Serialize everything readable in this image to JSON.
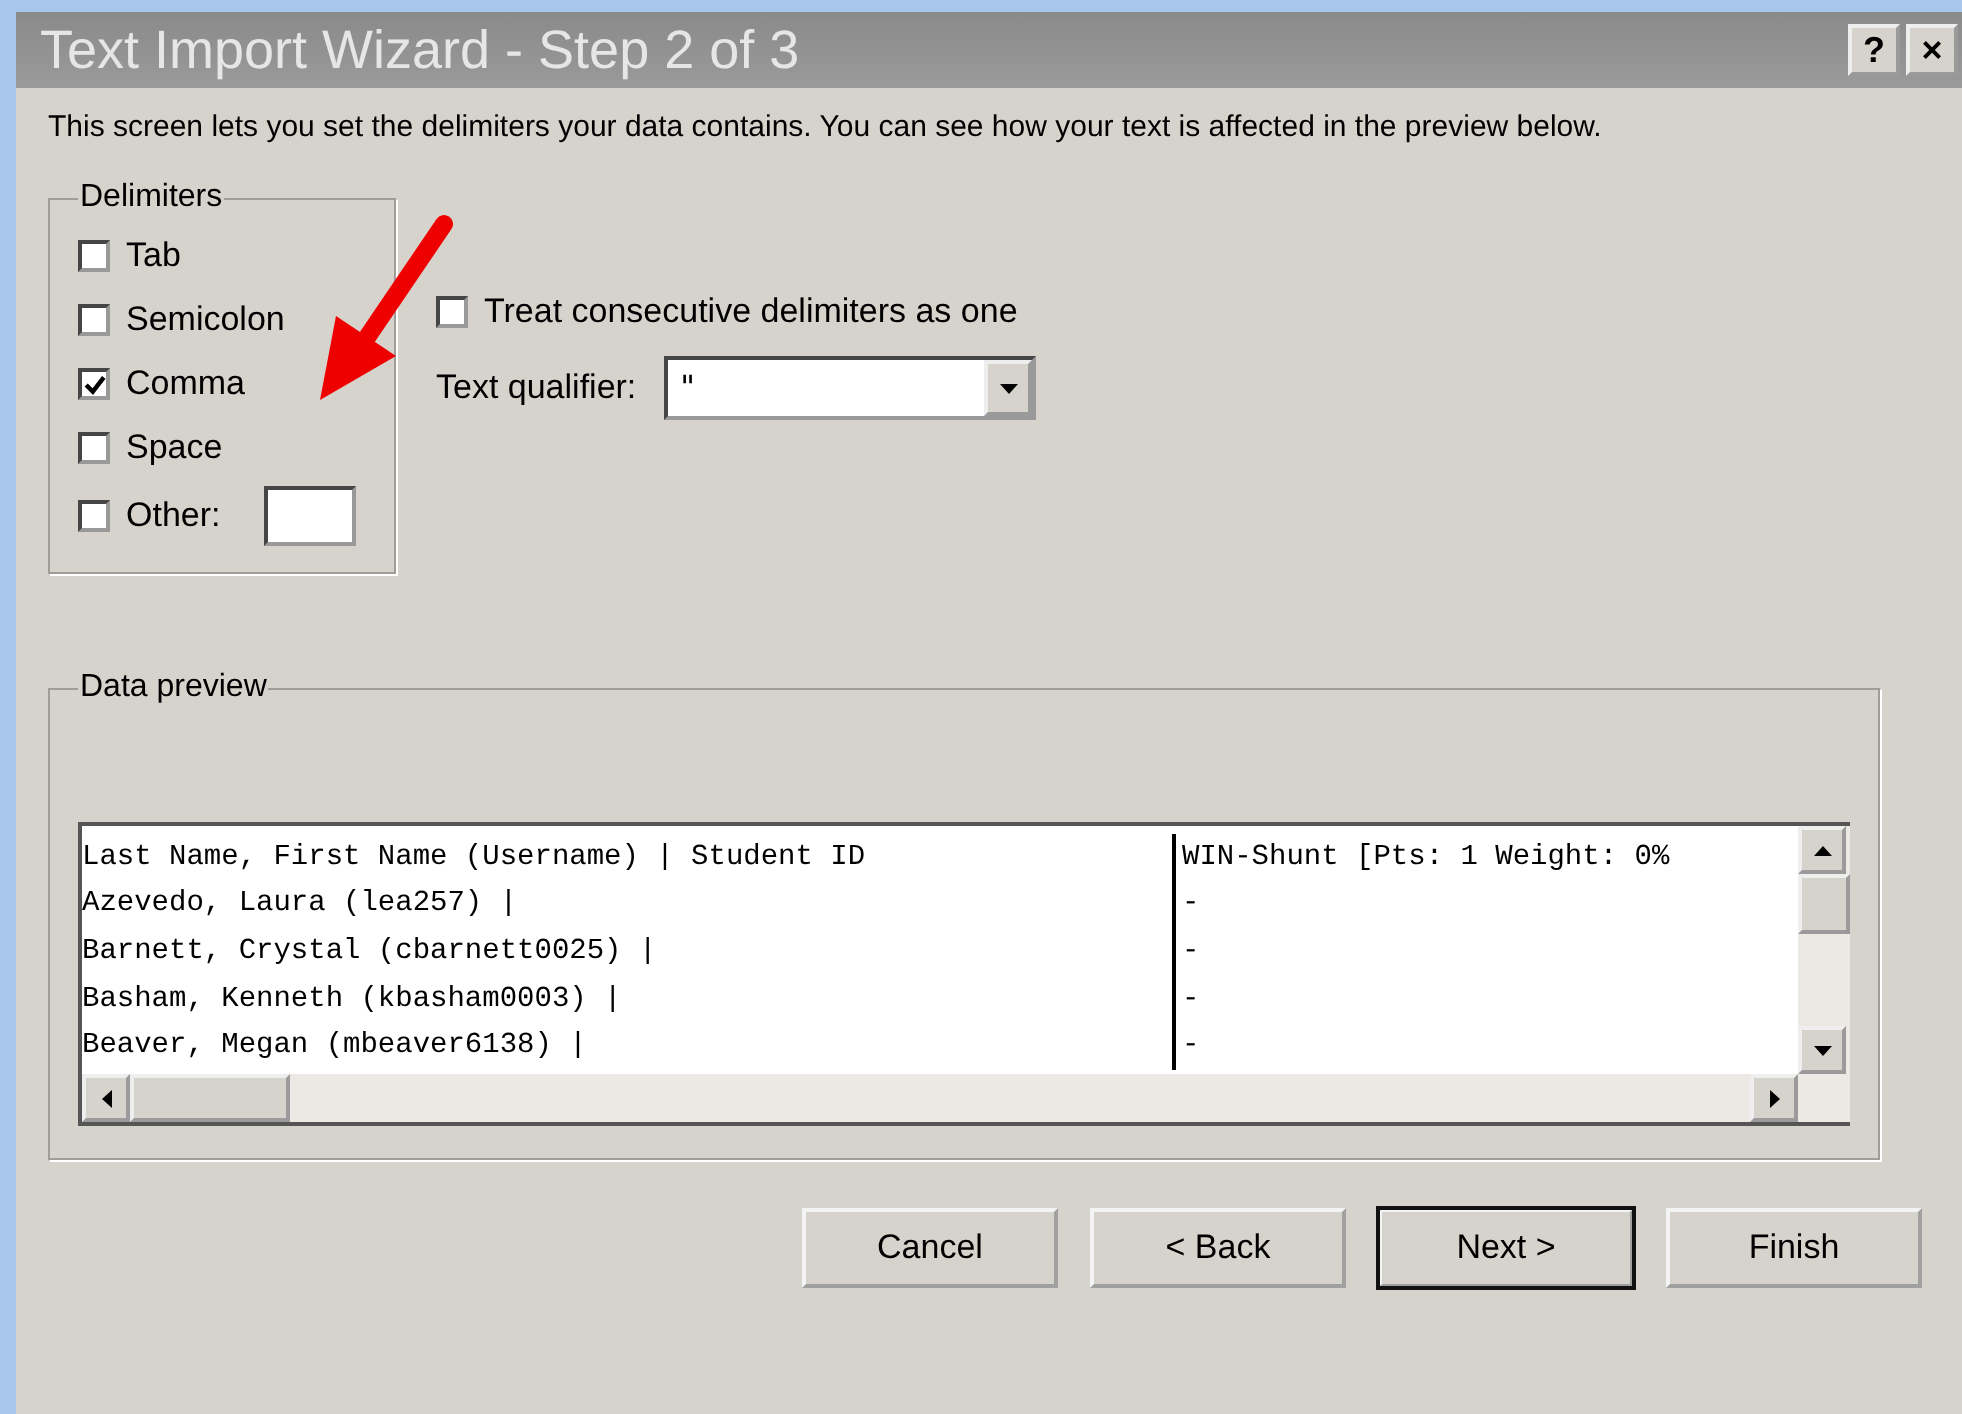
{
  "window": {
    "title": "Text Import Wizard - Step 2 of 3",
    "help_button": "?",
    "close_button": "×"
  },
  "intro": "This screen lets you set the delimiters your data contains.  You can see how your text is affected in the preview below.",
  "delimiters": {
    "label": "Delimiters",
    "items": [
      {
        "label": "Tab",
        "checked": false
      },
      {
        "label": "Semicolon",
        "checked": false
      },
      {
        "label": "Comma",
        "checked": true
      },
      {
        "label": "Space",
        "checked": false
      },
      {
        "label": "Other:",
        "checked": false,
        "kind": "other"
      }
    ]
  },
  "treat_consecutive": {
    "label": "Treat consecutive delimiters as one",
    "checked": false
  },
  "text_qualifier": {
    "label": "Text qualifier:",
    "value": "\""
  },
  "data_preview": {
    "label": "Data preview",
    "rows": [
      [
        "Last Name, First Name (Username) | Student ID",
        "WIN-Shunt [Pts: 1 Weight: 0%"
      ],
      [
        "Azevedo, Laura (lea257) |",
        "-"
      ],
      [
        "Barnett, Crystal (cbarnett0025) |",
        "-"
      ],
      [
        "Basham, Kenneth (kbasham0003) |",
        "-"
      ],
      [
        "Beaver, Megan (mbeaver6138) |",
        "-"
      ]
    ]
  },
  "buttons": [
    {
      "label": "Cancel",
      "default": false
    },
    {
      "label": "< Back",
      "default": false
    },
    {
      "label": "Next >",
      "default": true
    },
    {
      "label": "Finish",
      "default": false
    }
  ]
}
